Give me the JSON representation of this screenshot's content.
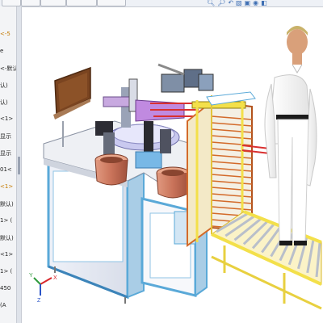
{
  "feature_tree": {
    "rows": [
      {
        "text": "<-5",
        "color": "#c47a00"
      },
      {
        "text": "e",
        "color": "#222222"
      },
      {
        "text": "<-默认",
        "color": "#222222"
      },
      {
        "text": "认)",
        "color": "#222222"
      },
      {
        "text": "认)",
        "color": "#222222"
      },
      {
        "text": "<1>",
        "color": "#222222"
      },
      {
        "text": "显示",
        "color": "#222222"
      },
      {
        "text": "显示",
        "color": "#222222"
      },
      {
        "text": "01<",
        "color": "#222222"
      },
      {
        "text": "<1>",
        "color": "#c47a00"
      },
      {
        "text": "默认)",
        "color": "#222222"
      },
      {
        "text": "1> (",
        "color": "#222222"
      },
      {
        "text": "默认)",
        "color": "#222222"
      },
      {
        "text": "<1>",
        "color": "#222222"
      },
      {
        "text": "1> (",
        "color": "#222222"
      },
      {
        "text": "450",
        "color": "#222222"
      },
      {
        "text": "(A",
        "color": "#222222"
      }
    ]
  },
  "view_toolbar": {
    "icons": [
      "zoom-fit-icon",
      "zoom-area-icon",
      "previous-view-icon",
      "section-view-icon",
      "view-orientation-icon",
      "display-style-icon",
      "hide-show-icon"
    ]
  },
  "triad": {
    "x_label": "X",
    "y_label": "Y",
    "z_label": "Z",
    "x_color": "#d9262b",
    "y_color": "#2f9a3c",
    "z_color": "#2a54c7"
  },
  "colors": {
    "frame_blue": "#63b6e6",
    "panel_white": "#f4f6fb",
    "panel_lilac": "#c9c9ef",
    "rack_yellow": "#f3e04a",
    "rack_orange": "#d36a2a",
    "bowl_copper": "#c9735a",
    "monitor_brown": "#7a4420",
    "shirt_white": "#f5f5f5",
    "pants_black": "#1b1b1b"
  }
}
